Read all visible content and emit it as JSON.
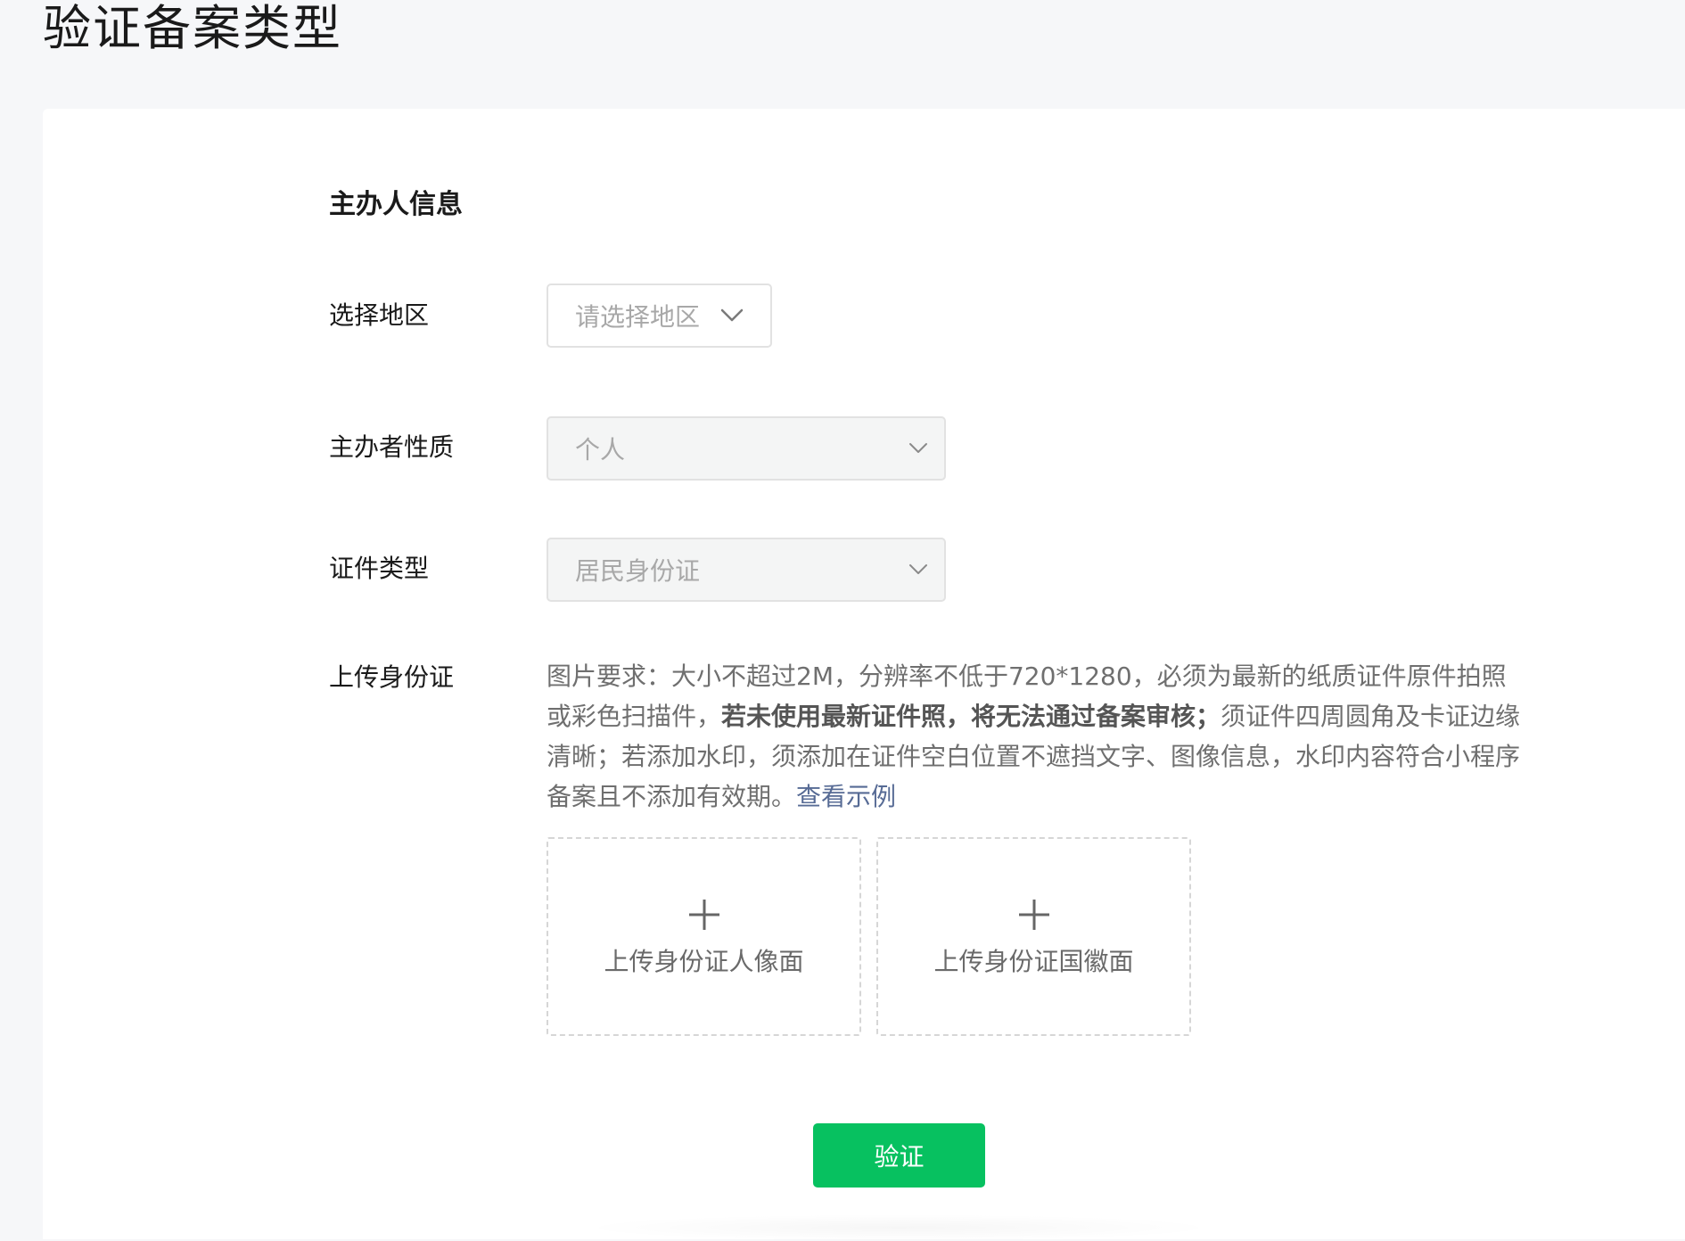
{
  "page": {
    "title": "验证备案类型"
  },
  "form": {
    "section_title": "主办人信息",
    "region": {
      "label": "选择地区",
      "placeholder": "请选择地区"
    },
    "organizer_nature": {
      "label": "主办者性质",
      "value": "个人"
    },
    "id_type": {
      "label": "证件类型",
      "value": "居民身份证"
    },
    "upload": {
      "label": "上传身份证",
      "requirements_part1": "图片要求：大小不超过2M，分辨率不低于720*1280，必须为最新的纸质证件原件拍照或彩色扫描件，",
      "requirements_bold": "若未使用最新证件照，将无法通过备案审核；",
      "requirements_part2": "须证件四周圆角及卡证边缘清晰；若添加水印，须添加在证件空白位置不遮挡文字、图像信息，水印内容符合小程序备案且不添加有效期。",
      "example_link": "查看示例",
      "front_label": "上传身份证人像面",
      "back_label": "上传身份证国徽面"
    },
    "submit_label": "验证"
  },
  "colors": {
    "accent_green": "#07c160",
    "link_blue": "#576b95",
    "page_background": "#f6f7f9",
    "card_background": "#ffffff"
  },
  "icons": {
    "select_chevron": "chevron-down-icon",
    "upload_plus": "plus-icon"
  }
}
